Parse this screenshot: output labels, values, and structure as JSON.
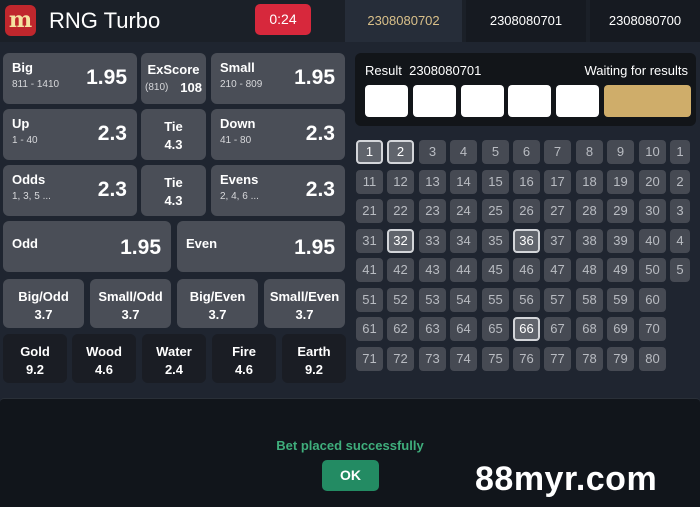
{
  "header": {
    "logo_glyph": "m",
    "title": "RNG Turbo",
    "timer": "0:24",
    "tabs": [
      {
        "label": "2308080702",
        "active": true
      },
      {
        "label": "2308080701",
        "active": false
      },
      {
        "label": "2308080700",
        "active": false
      }
    ]
  },
  "bets": {
    "big": {
      "name": "Big",
      "range": "811 - 1410",
      "odds": "1.95"
    },
    "exscore": {
      "name": "ExScore",
      "value_label": "(810)",
      "odds": "108"
    },
    "small": {
      "name": "Small",
      "range": "210 - 809",
      "odds": "1.95"
    },
    "up": {
      "name": "Up",
      "range": "1 - 40",
      "odds": "2.3"
    },
    "tie1": {
      "name": "Tie",
      "odds": "4.3"
    },
    "down": {
      "name": "Down",
      "range": "41 - 80",
      "odds": "2.3"
    },
    "odds": {
      "name": "Odds",
      "range": "1, 3, 5 ...",
      "odds": "2.3"
    },
    "tie2": {
      "name": "Tie",
      "odds": "4.3"
    },
    "evens": {
      "name": "Evens",
      "range": "2, 4, 6 ...",
      "odds": "2.3"
    },
    "odd": {
      "name": "Odd",
      "odds": "1.95"
    },
    "even": {
      "name": "Even",
      "odds": "1.95"
    },
    "big_odd": {
      "name": "Big/Odd",
      "odds": "3.7"
    },
    "small_odd": {
      "name": "Small/Odd",
      "odds": "3.7"
    },
    "big_even": {
      "name": "Big/Even",
      "odds": "3.7"
    },
    "small_even": {
      "name": "Small/Even",
      "odds": "3.7"
    },
    "gold": {
      "name": "Gold",
      "odds": "9.2"
    },
    "wood": {
      "name": "Wood",
      "odds": "4.6"
    },
    "water": {
      "name": "Water",
      "odds": "2.4"
    },
    "fire": {
      "name": "Fire",
      "odds": "4.6"
    },
    "earth": {
      "name": "Earth",
      "odds": "9.2"
    }
  },
  "result": {
    "label": "Result",
    "draw_id": "2308080701",
    "status": "Waiting for results"
  },
  "numbers": {
    "highlighted": [
      1,
      2,
      32,
      36,
      66
    ],
    "edge_column": [
      "1",
      "2",
      "3",
      "4",
      "5"
    ]
  },
  "notification": {
    "message": "Bet placed successfully",
    "ok_label": "OK"
  },
  "watermark": "88myr.com",
  "colors": {
    "accent_gold": "#cfad6a",
    "timer_red": "#d7283c",
    "success_green": "#3fae7c",
    "ok_button": "#238b63"
  }
}
